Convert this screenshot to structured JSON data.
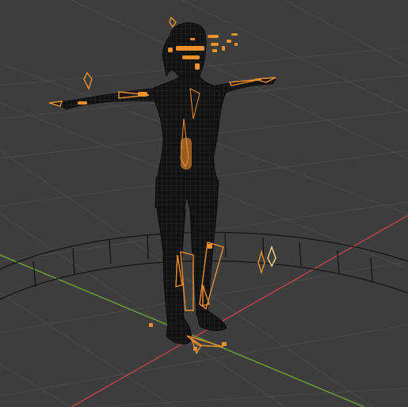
{
  "app": {
    "name": "3D viewport",
    "view": "perspective"
  },
  "scene": {
    "object": "character-mesh",
    "display_mode": "wireframe",
    "selection_state": "armature-bones-selected",
    "visible_text": []
  },
  "colors": {
    "background": "#3d3d3d",
    "grid_line": "#4a4a4a",
    "x_axis": "#b8414a",
    "y_axis": "#6a9a36",
    "mesh_fill": "#111111",
    "mesh_wire": "#2a2a2a",
    "bone_selected": "#f0902a",
    "bone_active": "#f5d380",
    "boundary_curve": "#141414"
  },
  "icons": {
    "bone": "octahedral-bone-icon"
  }
}
